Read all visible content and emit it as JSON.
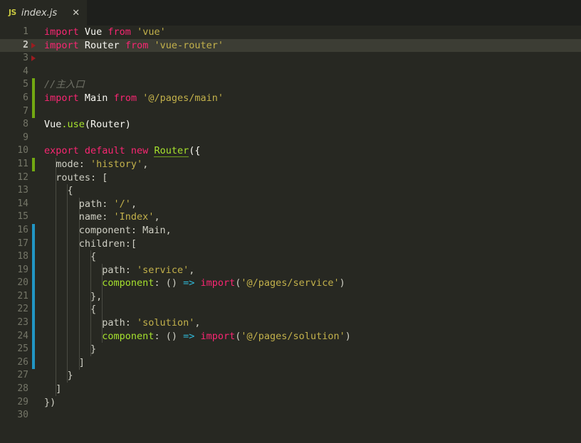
{
  "window": {
    "app": "code-editor",
    "theme_background": "#272822"
  },
  "tabbar": {
    "tabs": [
      {
        "icon_label": "JS",
        "icon_name": "javascript-file-icon",
        "title": "index.js",
        "close_label": "✕",
        "active": true
      }
    ]
  },
  "editor": {
    "language": "javascript",
    "active_line": 2,
    "total_lines": 30,
    "colors": {
      "keyword": "#f92672",
      "string": "#c3b14b",
      "identifier": "#f8f8f2",
      "function": "#a6e22e",
      "operator": "#2fb9d8",
      "comment": "#6f7066",
      "line_number": "#757668",
      "active_line_bg": "#3c3d34",
      "change_added": "#72a812",
      "change_modified": "#2196c4",
      "fold_marker": "#9b1c20"
    },
    "gutter_markers": [
      {
        "line": 2,
        "type": "fold-arrow"
      },
      {
        "line": 3,
        "type": "fold-arrow"
      }
    ],
    "change_bars": [
      {
        "from_line": 5,
        "to_line": 7,
        "type": "added"
      },
      {
        "from_line": 11,
        "to_line": 11,
        "type": "added"
      },
      {
        "from_line": 16,
        "to_line": 26,
        "type": "modified"
      }
    ],
    "lines": [
      {
        "n": 1,
        "tokens": [
          {
            "t": "kw",
            "v": "import"
          },
          {
            "t": "plain",
            "v": " Vue "
          },
          {
            "t": "kw",
            "v": "from"
          },
          {
            "t": "plain",
            "v": " "
          },
          {
            "t": "str",
            "v": "'vue'"
          }
        ]
      },
      {
        "n": 2,
        "tokens": [
          {
            "t": "kw",
            "v": "import"
          },
          {
            "t": "plain",
            "v": " Router "
          },
          {
            "t": "kw",
            "v": "from"
          },
          {
            "t": "plain",
            "v": " "
          },
          {
            "t": "str",
            "v": "'vue-router'"
          }
        ]
      },
      {
        "n": 3,
        "tokens": []
      },
      {
        "n": 4,
        "tokens": []
      },
      {
        "n": 5,
        "tokens": [
          {
            "t": "comment",
            "v": "//主入口"
          }
        ]
      },
      {
        "n": 6,
        "tokens": [
          {
            "t": "kw",
            "v": "import"
          },
          {
            "t": "plain",
            "v": " Main "
          },
          {
            "t": "kw",
            "v": "from"
          },
          {
            "t": "plain",
            "v": " "
          },
          {
            "t": "str",
            "v": "'@/pages/main'"
          }
        ]
      },
      {
        "n": 7,
        "tokens": []
      },
      {
        "n": 8,
        "tokens": [
          {
            "t": "plain",
            "v": "Vue"
          },
          {
            "t": "fn",
            "v": ".use"
          },
          {
            "t": "plain",
            "v": "(Router)"
          }
        ]
      },
      {
        "n": 9,
        "tokens": []
      },
      {
        "n": 10,
        "tokens": [
          {
            "t": "kw",
            "v": "export default new"
          },
          {
            "t": "plain",
            "v": " "
          },
          {
            "t": "under",
            "v": "Router"
          },
          {
            "t": "plain",
            "v": "({"
          }
        ]
      },
      {
        "n": 11,
        "tokens": [
          {
            "t": "prop",
            "v": "  mode: "
          },
          {
            "t": "str",
            "v": "'history'"
          },
          {
            "t": "prop",
            "v": ","
          }
        ]
      },
      {
        "n": 12,
        "tokens": [
          {
            "t": "prop",
            "v": "  routes: ["
          }
        ]
      },
      {
        "n": 13,
        "tokens": [
          {
            "t": "prop",
            "v": "    {"
          }
        ]
      },
      {
        "n": 14,
        "tokens": [
          {
            "t": "prop",
            "v": "      path: "
          },
          {
            "t": "str",
            "v": "'/'"
          },
          {
            "t": "prop",
            "v": ","
          }
        ]
      },
      {
        "n": 15,
        "tokens": [
          {
            "t": "prop",
            "v": "      name: "
          },
          {
            "t": "str",
            "v": "'Index'"
          },
          {
            "t": "prop",
            "v": ","
          }
        ]
      },
      {
        "n": 16,
        "tokens": [
          {
            "t": "prop",
            "v": "      component: Main,"
          }
        ]
      },
      {
        "n": 17,
        "tokens": [
          {
            "t": "prop",
            "v": "      children:["
          }
        ]
      },
      {
        "n": 18,
        "tokens": [
          {
            "t": "prop",
            "v": "        {"
          }
        ]
      },
      {
        "n": 19,
        "tokens": [
          {
            "t": "prop",
            "v": "          path: "
          },
          {
            "t": "str",
            "v": "'service'"
          },
          {
            "t": "prop",
            "v": ","
          }
        ]
      },
      {
        "n": 20,
        "tokens": [
          {
            "t": "fn",
            "v": "          component"
          },
          {
            "t": "prop",
            "v": ": () "
          },
          {
            "t": "op",
            "v": "=>"
          },
          {
            "t": "prop",
            "v": " "
          },
          {
            "t": "kw",
            "v": "import"
          },
          {
            "t": "prop",
            "v": "("
          },
          {
            "t": "str",
            "v": "'@/pages/service'"
          },
          {
            "t": "prop",
            "v": ")"
          }
        ]
      },
      {
        "n": 21,
        "tokens": [
          {
            "t": "prop",
            "v": "        },"
          }
        ]
      },
      {
        "n": 22,
        "tokens": [
          {
            "t": "prop",
            "v": "        {"
          }
        ]
      },
      {
        "n": 23,
        "tokens": [
          {
            "t": "prop",
            "v": "          path: "
          },
          {
            "t": "str",
            "v": "'solution'"
          },
          {
            "t": "prop",
            "v": ","
          }
        ]
      },
      {
        "n": 24,
        "tokens": [
          {
            "t": "fn",
            "v": "          component"
          },
          {
            "t": "prop",
            "v": ": () "
          },
          {
            "t": "op",
            "v": "=>"
          },
          {
            "t": "prop",
            "v": " "
          },
          {
            "t": "kw",
            "v": "import"
          },
          {
            "t": "prop",
            "v": "("
          },
          {
            "t": "str",
            "v": "'@/pages/solution'"
          },
          {
            "t": "prop",
            "v": ")"
          }
        ]
      },
      {
        "n": 25,
        "tokens": [
          {
            "t": "prop",
            "v": "        }"
          }
        ]
      },
      {
        "n": 26,
        "tokens": [
          {
            "t": "prop",
            "v": "      ]"
          }
        ]
      },
      {
        "n": 27,
        "tokens": [
          {
            "t": "prop",
            "v": "    }"
          }
        ]
      },
      {
        "n": 28,
        "tokens": [
          {
            "t": "prop",
            "v": "  ]"
          }
        ]
      },
      {
        "n": 29,
        "tokens": [
          {
            "t": "prop",
            "v": "})"
          }
        ]
      },
      {
        "n": 30,
        "tokens": []
      }
    ],
    "indent_guides": [
      {
        "col": 1,
        "from_line": 11,
        "to_line": 28
      },
      {
        "col": 2,
        "from_line": 13,
        "to_line": 27
      },
      {
        "col": 3,
        "from_line": 14,
        "to_line": 26
      },
      {
        "col": 4,
        "from_line": 18,
        "to_line": 25
      },
      {
        "col": 5,
        "from_line": 19,
        "to_line": 24
      }
    ]
  }
}
